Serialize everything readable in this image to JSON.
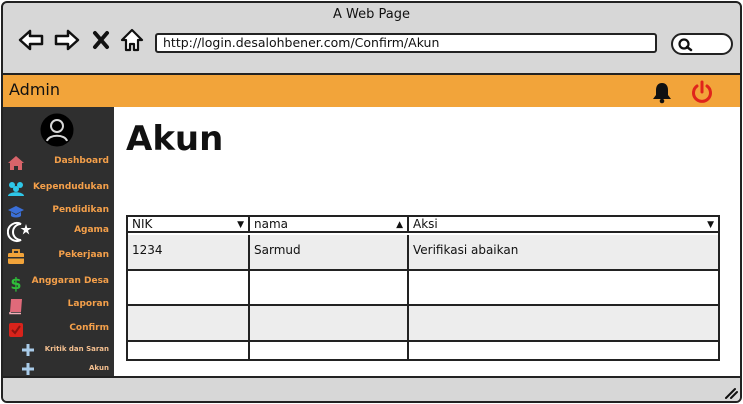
{
  "window": {
    "title": "A Web Page"
  },
  "browser": {
    "url": "http://login.desalohbener.com/Confirm/Akun",
    "nav_icons": [
      "back-arrow-icon",
      "forward-arrow-icon",
      "close-x-icon",
      "home-icon"
    ],
    "search_icon": "search-icon"
  },
  "header": {
    "title": "Admin",
    "icons": [
      "bell-icon",
      "power-icon"
    ],
    "accent_color": "#f2a43a",
    "power_color": "#e0241b"
  },
  "sidebar": {
    "avatar_icon": "user-avatar-icon",
    "items": [
      {
        "label": "Dashboard",
        "icon": "home-icon",
        "icon_color": "#d8646a"
      },
      {
        "label": "Kependudukan",
        "icon": "users-icon",
        "icon_color": "#2ec7e8"
      },
      {
        "label": "Pendidikan",
        "icon": "graduation-cap-icon",
        "icon_color": "#3a6fd8"
      },
      {
        "label": "Agama",
        "icon": "moon-star-icon",
        "icon_color": "#ffffff"
      },
      {
        "label": "Pekerjaan",
        "icon": "briefcase-icon",
        "icon_color": "#f2a43a"
      },
      {
        "label": "Anggaran Desa",
        "icon": "dollar-icon",
        "icon_color": "#2fbf3a"
      },
      {
        "label": "Laporan",
        "icon": "book-icon",
        "icon_color": "#e06a7a"
      },
      {
        "label": "Confirm",
        "icon": "check-square-icon",
        "icon_color": "#d8231b"
      },
      {
        "label": "Kritik dan Saran",
        "icon": "plus-icon",
        "icon_color": "#a9cbe8"
      },
      {
        "label": "Akun",
        "icon": "plus-icon",
        "icon_color": "#a9cbe8"
      }
    ]
  },
  "main": {
    "title": "Akun",
    "table": {
      "columns": [
        {
          "label": "NIK",
          "sort": "desc"
        },
        {
          "label": "nama",
          "sort": "asc"
        },
        {
          "label": "Aksi",
          "sort": "desc"
        }
      ],
      "rows": [
        [
          "1234",
          "Sarmud",
          "Verifikasi abaikan"
        ],
        [
          "",
          "",
          ""
        ],
        [
          "",
          "",
          ""
        ],
        [
          "",
          "",
          ""
        ]
      ]
    }
  }
}
